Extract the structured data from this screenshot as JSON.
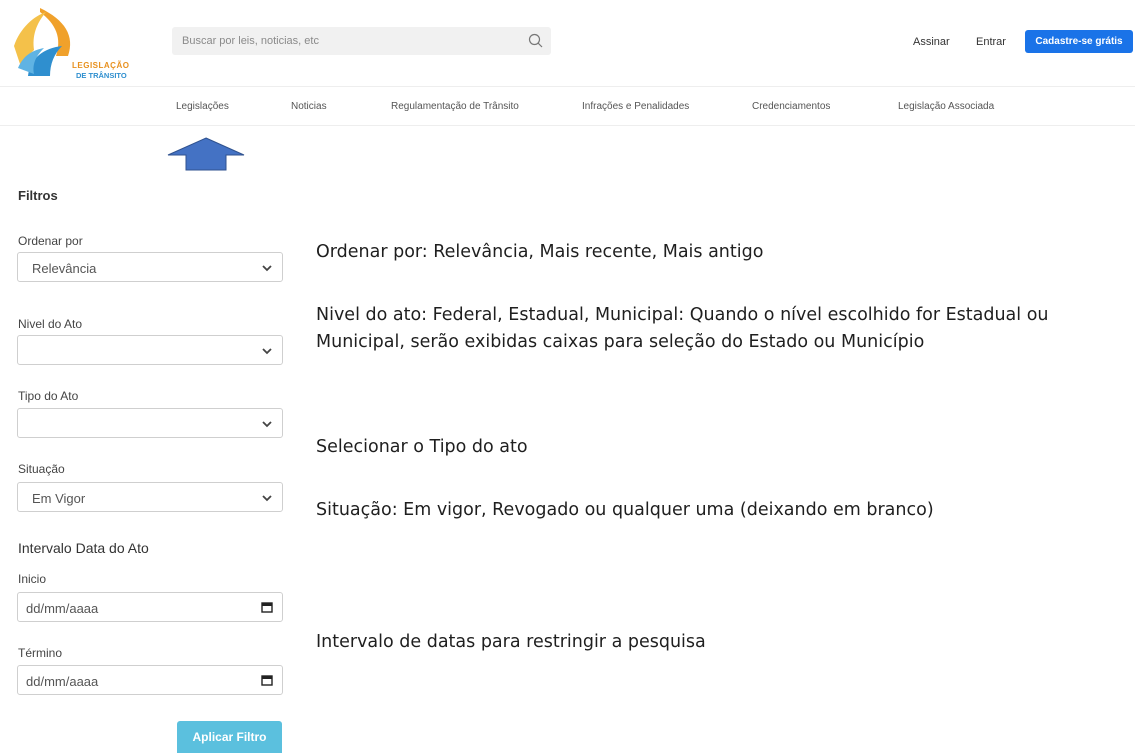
{
  "brand": {
    "line1": "LEGISLAÇÃO",
    "line2": "DE TRÂNSITO"
  },
  "search": {
    "placeholder": "Buscar por leis, noticias, etc",
    "icon": "search-icon"
  },
  "header": {
    "assinar_label": "Assinar",
    "entrar_label": "Entrar",
    "cadastre_label": "Cadastre-se grátis",
    "accent_color": "#1a73e8"
  },
  "nav": {
    "items": [
      "Legislações",
      "Noticias",
      "Regulamentação de Trânsito",
      "Infrações e Penalidades",
      "Credenciamentos",
      "Legislação Associada"
    ]
  },
  "filters": {
    "heading": "Filtros",
    "ordenar_label": "Ordenar por",
    "ordenar_value": "Relevância",
    "nivel_label": "Nivel do Ato",
    "nivel_value": "",
    "tipo_label": "Tipo do Ato",
    "tipo_value": "",
    "situacao_label": "Situação",
    "situacao_value": "Em Vigor",
    "intervalo_heading": "Intervalo Data do Ato",
    "inicio_label": "Inicio",
    "inicio_value": "dd/mm/aaaa",
    "termino_label": "Término",
    "termino_value": "dd/mm/aaaa",
    "apply_label": "Aplicar Filtro",
    "apply_color": "#5bc0de"
  },
  "annotations": {
    "ordenar": "Ordenar por: Relevância, Mais recente, Mais antigo",
    "nivel": "Nivel do ato: Federal, Estadual, Municipal: Quando o nível escolhido for Estadual ou Municipal, serão exibidas caixas para seleção do Estado ou Município",
    "tipo": "Selecionar o Tipo do ato",
    "situacao": "Situação: Em vigor, Revogado ou qualquer uma (deixando em branco)",
    "intervalo": "Intervalo de datas para restringir a pesquisa",
    "arrow_color": "#4472c4"
  }
}
